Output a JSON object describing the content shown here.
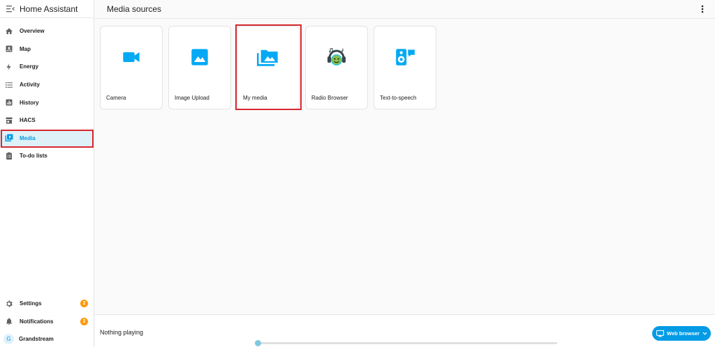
{
  "app": {
    "title": "Home Assistant"
  },
  "sidebar": {
    "items": [
      {
        "label": "Overview",
        "icon": "home-icon"
      },
      {
        "label": "Map",
        "icon": "map-icon"
      },
      {
        "label": "Energy",
        "icon": "lightning-icon"
      },
      {
        "label": "Activity",
        "icon": "list-icon"
      },
      {
        "label": "History",
        "icon": "chart-box-icon"
      },
      {
        "label": "HACS",
        "icon": "store-icon"
      },
      {
        "label": "Media",
        "icon": "media-library-icon",
        "active": true
      },
      {
        "label": "To-do lists",
        "icon": "clipboard-list-icon"
      }
    ],
    "bottom": [
      {
        "label": "Settings",
        "icon": "gear-icon",
        "badge": "2"
      },
      {
        "label": "Notifications",
        "icon": "bell-icon",
        "badge": "2"
      },
      {
        "label": "Grandstream",
        "avatar": "G"
      }
    ]
  },
  "main": {
    "title": "Media sources",
    "sources": [
      {
        "label": "Camera",
        "icon": "video-camera-icon"
      },
      {
        "label": "Image Upload",
        "icon": "image-icon"
      },
      {
        "label": "My media",
        "icon": "image-multiple-icon"
      },
      {
        "label": "Radio Browser",
        "icon": "radio-browser-logo-icon"
      },
      {
        "label": "Text-to-speech",
        "icon": "speaker-message-icon"
      }
    ]
  },
  "player": {
    "status": "Nothing playing",
    "progress": 0,
    "target_label": "Web browser"
  },
  "colors": {
    "accent": "#039be5",
    "badge": "#ff9800",
    "highlight": "#d7282f",
    "active_bg": "#dff1f8",
    "icon_grey": "#616161"
  }
}
